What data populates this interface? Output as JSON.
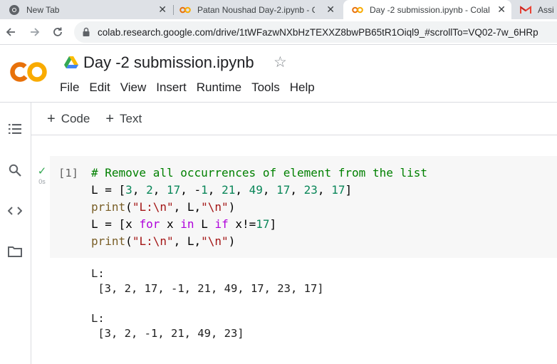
{
  "browser": {
    "tabs": [
      {
        "title": "New Tab",
        "active": false
      },
      {
        "title": "Patan Noushad Day-2.ipynb - Co",
        "active": false
      },
      {
        "title": "Day -2 submission.ipynb - Colab",
        "active": true
      },
      {
        "title": "Assi",
        "active": false
      }
    ],
    "close_glyph": "✕",
    "url": "colab.research.google.com/drive/1tWFazwNXbHzTEXXZ8bwPB65tR1Oiql9_#scrollTo=VQ02-7w_6HRp"
  },
  "colab": {
    "logo_text": "CO",
    "notebook_title": "Day -2 submission.ipynb",
    "star_glyph": "☆",
    "menu": [
      "File",
      "Edit",
      "View",
      "Insert",
      "Runtime",
      "Tools",
      "Help"
    ],
    "add_code_label": "Code",
    "add_text_label": "Text",
    "plus_glyph": "+"
  },
  "cell": {
    "execution_count": "[1]",
    "status_check": "✓",
    "exec_time": "0s",
    "code_lines": [
      "# Remove all occurrences of element from the list",
      "L = [3, 2, 17, -1, 21, 49, 17, 23, 17]",
      "print(\"L:\\n\", L,\"\\n\")",
      "L = [x for x in L if x!=17]",
      "print(\"L:\\n\", L,\"\\n\")"
    ],
    "output_lines": [
      "L:",
      " [3, 2, 17, -1, 21, 49, 17, 23, 17]",
      "",
      "L:",
      " [3, 2, -1, 21, 49, 23]"
    ]
  },
  "colors": {
    "colab_orange": "#f9ab00",
    "colab_orange_dark": "#e8710a",
    "comment_green": "#008000",
    "number_green": "#098658",
    "keyword_purple": "#af00db",
    "string_red": "#a31515"
  }
}
